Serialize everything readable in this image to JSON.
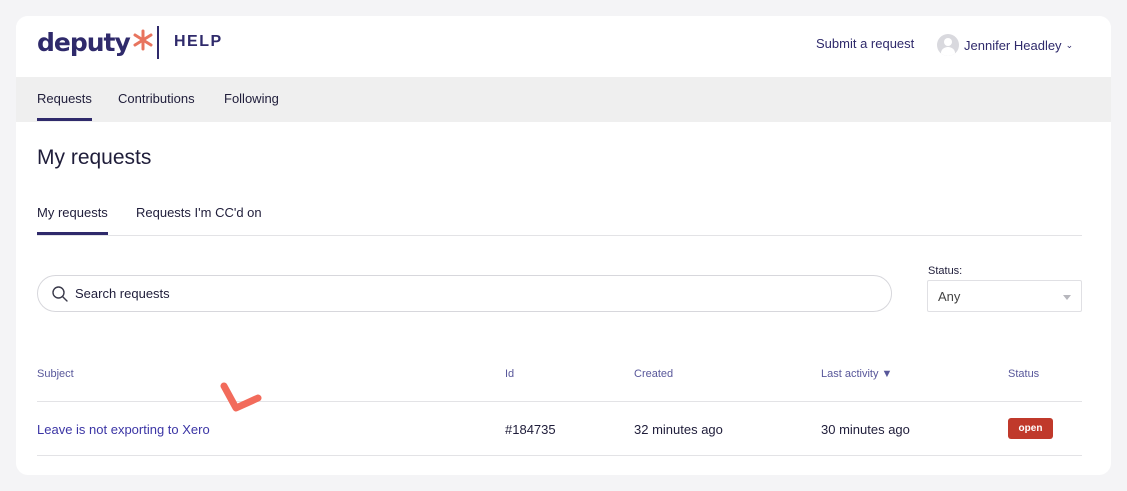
{
  "header": {
    "logo_text": "deputy",
    "help_label": "HELP",
    "submit_request": "Submit a request",
    "user_name": "Jennifer Headley",
    "brand_color": "#2f2a6b",
    "logo_accent_color": "#e8745e"
  },
  "subnav": {
    "items": [
      {
        "label": "Requests",
        "active": true
      },
      {
        "label": "Contributions",
        "active": false
      },
      {
        "label": "Following",
        "active": false
      }
    ]
  },
  "page": {
    "title": "My requests"
  },
  "tabs": [
    {
      "label": "My requests",
      "active": true
    },
    {
      "label": "Requests I'm CC'd on",
      "active": false
    }
  ],
  "search": {
    "placeholder": "Search requests"
  },
  "status_filter": {
    "label": "Status:",
    "value": "Any"
  },
  "table": {
    "columns": [
      "Subject",
      "Id",
      "Created",
      "Last activity",
      "Status"
    ],
    "sort_indicator": "▼",
    "rows": [
      {
        "subject": "Leave is not exporting to Xero",
        "id": "#184735",
        "created": "32 minutes ago",
        "last_activity": "30 minutes ago",
        "status": "open"
      }
    ]
  },
  "colors": {
    "status_open": "#c0392b",
    "link": "#3b35a5",
    "annotation": "#f26b5b"
  }
}
